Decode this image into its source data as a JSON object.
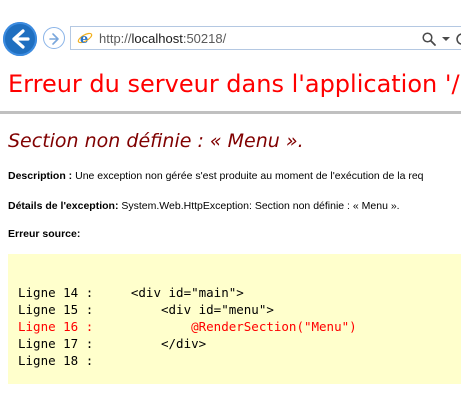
{
  "browser": {
    "url_prefix": "http://",
    "url_host": "localhost",
    "url_port": ":50218/"
  },
  "page": {
    "title": "Erreur du serveur dans l'application '/",
    "subtitle": "Section non définie : « Menu ».",
    "description_label": "Description :",
    "description_text": " Une exception non gérée s'est produite au moment de l'exécution de la req",
    "exception_label": "Détails de l'exception:",
    "exception_text": " System.Web.HttpException: Section non définie : « Menu ».",
    "source_label": "Erreur source:"
  },
  "source_code": [
    {
      "text": "Ligne 14 :     <div id=\"main\">"
    },
    {
      "text": "Ligne 15 :         <div id=\"menu\">"
    },
    {
      "text": "Ligne 16 :             @RenderSection(\"Menu\")"
    },
    {
      "text": "Ligne 17 :         </div>"
    },
    {
      "text": "Ligne 18 :"
    }
  ],
  "colors": {
    "title": "#ff0000",
    "subtitle": "#800000",
    "code_background": "#ffffcc",
    "error_line": "#ff0000",
    "back_button": "#1f6fc0"
  }
}
